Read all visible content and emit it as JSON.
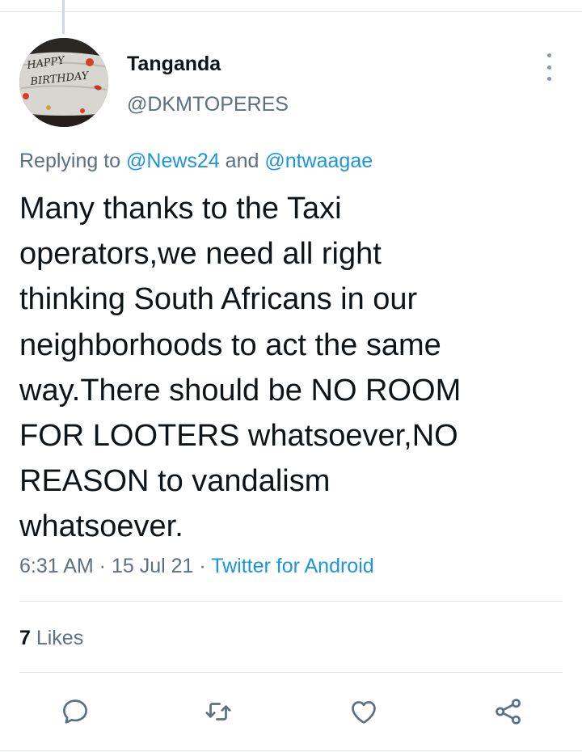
{
  "tweet": {
    "author": {
      "display_name": "Tanganda",
      "handle": "@DKMTOPERES",
      "avatar_text_line1": "HAPPY",
      "avatar_text_line2": "BIRTHDAY"
    },
    "reply": {
      "prefix": "Replying to ",
      "mention1": "@News24",
      "conjunction": " and ",
      "mention2": "@ntwaagae"
    },
    "text_lines": [
      "Many thanks to the Taxi",
      "operators,we need all right",
      "thinking South Africans in our",
      "neighborhoods to act the same",
      "way.There should be NO ROOM",
      "FOR LOOTERS whatsoever,NO",
      "REASON to vandalism",
      "whatsoever."
    ],
    "meta": {
      "time": "6:31 AM",
      "separator": " · ",
      "date": "15 Jul 21",
      "source": "Twitter for Android"
    },
    "likes": {
      "count": "7",
      "label": " Likes"
    }
  },
  "actions": {
    "reply_icon": "reply-icon",
    "retweet_icon": "retweet-icon",
    "like_icon": "heart-icon",
    "share_icon": "share-icon"
  },
  "colors": {
    "accent": "#1b95e0",
    "secondary_text": "#5b7083",
    "primary_text": "#0f1419",
    "divider": "#e1e6ea"
  }
}
